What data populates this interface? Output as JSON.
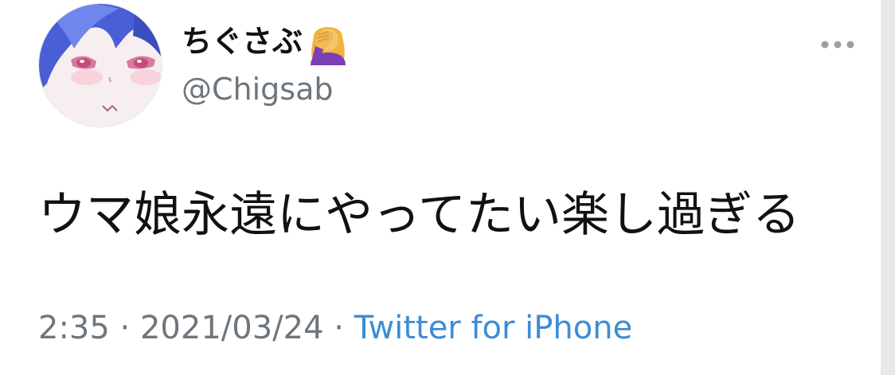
{
  "tweet": {
    "author": {
      "display_name": "ちぐさぶ",
      "name_emoji_icon": "facepalm-woman-icon",
      "handle": "@Chigsab"
    },
    "more_icon": "more-horizontal-icon",
    "text": "ウマ娘永遠にやってたい楽し過ぎる",
    "time": "2:35",
    "separator": " · ",
    "date": "2021/03/24",
    "source": "Twitter for iPhone",
    "colors": {
      "text": "#111111",
      "secondary": "#6e767d",
      "link": "#3d8cd6"
    }
  }
}
